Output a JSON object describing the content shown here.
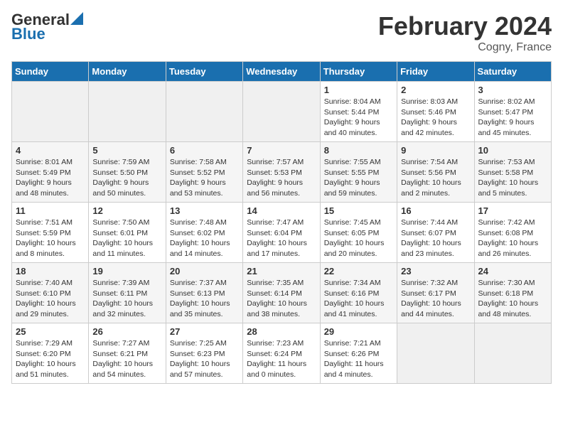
{
  "header": {
    "logo_line1": "General",
    "logo_line2": "Blue",
    "month_title": "February 2024",
    "location": "Cogny, France"
  },
  "weekdays": [
    "Sunday",
    "Monday",
    "Tuesday",
    "Wednesday",
    "Thursday",
    "Friday",
    "Saturday"
  ],
  "weeks": [
    [
      {
        "day": "",
        "info": ""
      },
      {
        "day": "",
        "info": ""
      },
      {
        "day": "",
        "info": ""
      },
      {
        "day": "",
        "info": ""
      },
      {
        "day": "1",
        "info": "Sunrise: 8:04 AM\nSunset: 5:44 PM\nDaylight: 9 hours\nand 40 minutes."
      },
      {
        "day": "2",
        "info": "Sunrise: 8:03 AM\nSunset: 5:46 PM\nDaylight: 9 hours\nand 42 minutes."
      },
      {
        "day": "3",
        "info": "Sunrise: 8:02 AM\nSunset: 5:47 PM\nDaylight: 9 hours\nand 45 minutes."
      }
    ],
    [
      {
        "day": "4",
        "info": "Sunrise: 8:01 AM\nSunset: 5:49 PM\nDaylight: 9 hours\nand 48 minutes."
      },
      {
        "day": "5",
        "info": "Sunrise: 7:59 AM\nSunset: 5:50 PM\nDaylight: 9 hours\nand 50 minutes."
      },
      {
        "day": "6",
        "info": "Sunrise: 7:58 AM\nSunset: 5:52 PM\nDaylight: 9 hours\nand 53 minutes."
      },
      {
        "day": "7",
        "info": "Sunrise: 7:57 AM\nSunset: 5:53 PM\nDaylight: 9 hours\nand 56 minutes."
      },
      {
        "day": "8",
        "info": "Sunrise: 7:55 AM\nSunset: 5:55 PM\nDaylight: 9 hours\nand 59 minutes."
      },
      {
        "day": "9",
        "info": "Sunrise: 7:54 AM\nSunset: 5:56 PM\nDaylight: 10 hours\nand 2 minutes."
      },
      {
        "day": "10",
        "info": "Sunrise: 7:53 AM\nSunset: 5:58 PM\nDaylight: 10 hours\nand 5 minutes."
      }
    ],
    [
      {
        "day": "11",
        "info": "Sunrise: 7:51 AM\nSunset: 5:59 PM\nDaylight: 10 hours\nand 8 minutes."
      },
      {
        "day": "12",
        "info": "Sunrise: 7:50 AM\nSunset: 6:01 PM\nDaylight: 10 hours\nand 11 minutes."
      },
      {
        "day": "13",
        "info": "Sunrise: 7:48 AM\nSunset: 6:02 PM\nDaylight: 10 hours\nand 14 minutes."
      },
      {
        "day": "14",
        "info": "Sunrise: 7:47 AM\nSunset: 6:04 PM\nDaylight: 10 hours\nand 17 minutes."
      },
      {
        "day": "15",
        "info": "Sunrise: 7:45 AM\nSunset: 6:05 PM\nDaylight: 10 hours\nand 20 minutes."
      },
      {
        "day": "16",
        "info": "Sunrise: 7:44 AM\nSunset: 6:07 PM\nDaylight: 10 hours\nand 23 minutes."
      },
      {
        "day": "17",
        "info": "Sunrise: 7:42 AM\nSunset: 6:08 PM\nDaylight: 10 hours\nand 26 minutes."
      }
    ],
    [
      {
        "day": "18",
        "info": "Sunrise: 7:40 AM\nSunset: 6:10 PM\nDaylight: 10 hours\nand 29 minutes."
      },
      {
        "day": "19",
        "info": "Sunrise: 7:39 AM\nSunset: 6:11 PM\nDaylight: 10 hours\nand 32 minutes."
      },
      {
        "day": "20",
        "info": "Sunrise: 7:37 AM\nSunset: 6:13 PM\nDaylight: 10 hours\nand 35 minutes."
      },
      {
        "day": "21",
        "info": "Sunrise: 7:35 AM\nSunset: 6:14 PM\nDaylight: 10 hours\nand 38 minutes."
      },
      {
        "day": "22",
        "info": "Sunrise: 7:34 AM\nSunset: 6:16 PM\nDaylight: 10 hours\nand 41 minutes."
      },
      {
        "day": "23",
        "info": "Sunrise: 7:32 AM\nSunset: 6:17 PM\nDaylight: 10 hours\nand 44 minutes."
      },
      {
        "day": "24",
        "info": "Sunrise: 7:30 AM\nSunset: 6:18 PM\nDaylight: 10 hours\nand 48 minutes."
      }
    ],
    [
      {
        "day": "25",
        "info": "Sunrise: 7:29 AM\nSunset: 6:20 PM\nDaylight: 10 hours\nand 51 minutes."
      },
      {
        "day": "26",
        "info": "Sunrise: 7:27 AM\nSunset: 6:21 PM\nDaylight: 10 hours\nand 54 minutes."
      },
      {
        "day": "27",
        "info": "Sunrise: 7:25 AM\nSunset: 6:23 PM\nDaylight: 10 hours\nand 57 minutes."
      },
      {
        "day": "28",
        "info": "Sunrise: 7:23 AM\nSunset: 6:24 PM\nDaylight: 11 hours\nand 0 minutes."
      },
      {
        "day": "29",
        "info": "Sunrise: 7:21 AM\nSunset: 6:26 PM\nDaylight: 11 hours\nand 4 minutes."
      },
      {
        "day": "",
        "info": ""
      },
      {
        "day": "",
        "info": ""
      }
    ]
  ]
}
